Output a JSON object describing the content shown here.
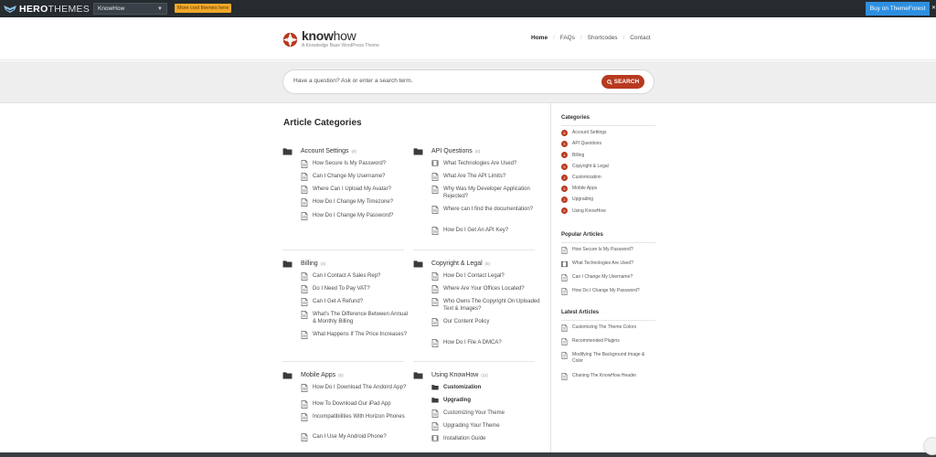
{
  "topbar": {
    "brand_part1": "HERO",
    "brand_part2": "THEMES",
    "theme_selected": "KnowHow",
    "more_themes": "More cool themes here",
    "buy_button": "Buy on ThemeForest"
  },
  "header": {
    "logo_bold": "know",
    "logo_light": "how",
    "tagline": "A Knowledge Base WordPress Theme",
    "nav": [
      "Home",
      "FAQs",
      "Shortcodes",
      "Contact"
    ]
  },
  "search": {
    "placeholder": "Have a question? Ask or enter a search term.",
    "button": "SEARCH"
  },
  "main": {
    "title": "Article Categories",
    "categories": [
      {
        "name": "Account Settings",
        "count": "(6)",
        "articles": [
          {
            "text": "How Secure Is My Password?",
            "icon": "doc"
          },
          {
            "text": "Can I Change My Username?",
            "icon": "doc"
          },
          {
            "text": "Where Can I Upload My Avatar?",
            "icon": "doc"
          },
          {
            "text": "How Do I Change My Timezone?",
            "icon": "doc"
          },
          {
            "text": "How Do I Change My Password?",
            "icon": "doc"
          }
        ]
      },
      {
        "name": "API Questions",
        "count": "(5)",
        "articles": [
          {
            "text": "What Technologies Are Used?",
            "icon": "film"
          },
          {
            "text": "What Are The API Limits?",
            "icon": "doc"
          },
          {
            "text": "Why Was My Developer Application Rejected?",
            "icon": "doc"
          },
          {
            "text": "Where can I find the documentation?",
            "icon": "doc"
          },
          {
            "text": "How Do I Get An API Key?",
            "icon": "doc"
          }
        ]
      },
      {
        "name": "Billing",
        "count": "(4)",
        "articles": [
          {
            "text": "Can I Contact A Sales Rep?",
            "icon": "doc"
          },
          {
            "text": "Do I Need To Pay VAT?",
            "icon": "doc"
          },
          {
            "text": "Can I Get A Refund?",
            "icon": "doc"
          },
          {
            "text": "What's The Difference Between Annual & Monthly Billing",
            "icon": "doc"
          },
          {
            "text": "What Happens If The Price Increases?",
            "icon": "doc"
          }
        ]
      },
      {
        "name": "Copyright & Legal",
        "count": "(5)",
        "articles": [
          {
            "text": "How Do I Contact Legal?",
            "icon": "doc"
          },
          {
            "text": "Where Are Your Offices Located?",
            "icon": "doc"
          },
          {
            "text": "Who Owns The Copyright On Uploaded Text & Images?",
            "icon": "doc"
          },
          {
            "text": "Our Content Policy",
            "icon": "doc"
          },
          {
            "text": "How Do I File A DMCA?",
            "icon": "doc"
          }
        ]
      },
      {
        "name": "Mobile Apps",
        "count": "(5)",
        "articles": [
          {
            "text": "How Do I Download The Andoird App?",
            "icon": "doc"
          },
          {
            "text": "How To Download Our iPad App",
            "icon": "doc"
          },
          {
            "text": "Incompatibilities With Horizon Phones",
            "icon": "doc"
          },
          {
            "text": "Can I Use My Android Phone?",
            "icon": "doc"
          }
        ]
      },
      {
        "name": "Using KnowHow",
        "count": "(11)",
        "articles": [
          {
            "text": "Customization",
            "icon": "folder",
            "bold": true
          },
          {
            "text": "Upgrading",
            "icon": "folder",
            "bold": true
          },
          {
            "text": "Customizing Your Theme",
            "icon": "doc"
          },
          {
            "text": "Upgrading Your Theme",
            "icon": "doc"
          },
          {
            "text": "Installation Guide",
            "icon": "film"
          }
        ]
      }
    ]
  },
  "sidebar": {
    "categories_title": "Categories",
    "categories": [
      {
        "num": "6",
        "name": "Account Settings"
      },
      {
        "num": "5",
        "name": "API Questions"
      },
      {
        "num": "4",
        "name": "Billing"
      },
      {
        "num": "5",
        "name": "Copyright & Legal"
      },
      {
        "num": "2",
        "name": "Customization"
      },
      {
        "num": "6",
        "name": "Mobile Apps"
      },
      {
        "num": "2",
        "name": "Upgrading"
      },
      {
        "num": "5",
        "name": "Using KnowHow"
      }
    ],
    "popular_title": "Popular Articles",
    "popular": [
      {
        "text": "How Secure Is My Password?",
        "icon": "doc"
      },
      {
        "text": "What Technologies Are Used?",
        "icon": "film"
      },
      {
        "text": "Can I Change My Username?",
        "icon": "doc"
      },
      {
        "text": "How Do I Change My Password?",
        "icon": "doc"
      }
    ],
    "latest_title": "Latest Articles",
    "latest": [
      {
        "text": "Customizing The Theme Colors",
        "icon": "doc"
      },
      {
        "text": "Recommended Plugins",
        "icon": "doc"
      },
      {
        "text": "Modifying The Background Image & Color",
        "icon": "doc"
      },
      {
        "text": "Chaning The KnowHow Header",
        "icon": "doc"
      }
    ]
  },
  "colors": {
    "accent": "#b73a1f",
    "topbar": "#262b30",
    "buy_button": "#2d8fe0"
  }
}
